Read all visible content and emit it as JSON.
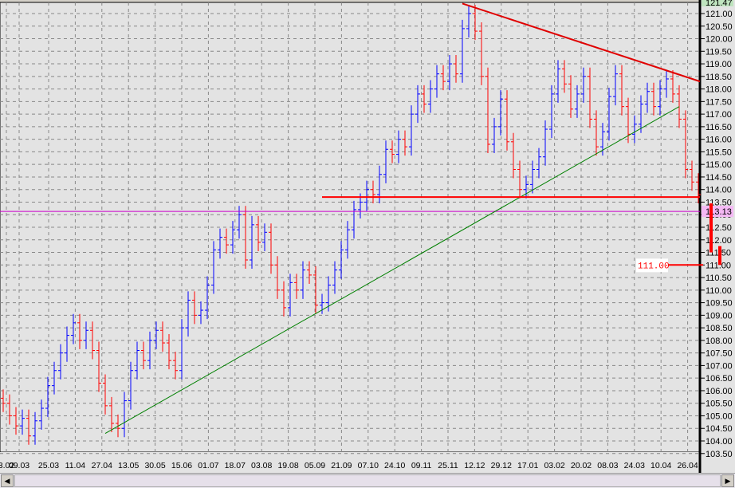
{
  "chart_data": {
    "type": "ohlc-bar",
    "ylim": [
      103.5,
      121.47
    ],
    "y_ticks": [
      103.5,
      104,
      104.5,
      105,
      105.5,
      106,
      106.5,
      107,
      107.5,
      108,
      108.5,
      109,
      109.5,
      110,
      110.5,
      111,
      111.5,
      112,
      112.5,
      113,
      113.5,
      114,
      114.5,
      115,
      115.5,
      116,
      116.5,
      117,
      117.5,
      118,
      118.5,
      119,
      119.5,
      120,
      120.5,
      121
    ],
    "x_labels": [
      "3.02",
      "09.03",
      "25.03",
      "11.04",
      "27.04",
      "13.05",
      "30.05",
      "15.06",
      "01.07",
      "18.07",
      "03.08",
      "19.08",
      "05.09",
      "21.09",
      "07.10",
      "24.10",
      "09.11",
      "25.11",
      "12.12",
      "29.12",
      "17.01",
      "03.02",
      "20.02",
      "08.03",
      "24.03",
      "10.04",
      "26.04"
    ],
    "closes": [
      105.5,
      105.0,
      104.6,
      104.9,
      104.2,
      104.8,
      105.3,
      106.2,
      106.8,
      107.5,
      108.2,
      108.7,
      108.0,
      108.4,
      107.6,
      106.3,
      105.4,
      104.7,
      104.5,
      105.6,
      106.8,
      107.6,
      107.2,
      108.0,
      108.4,
      107.9,
      107.2,
      106.8,
      108.5,
      109.6,
      109.0,
      109.2,
      110.2,
      111.6,
      112.1,
      111.8,
      112.4,
      113.0,
      111.2,
      112.6,
      111.9,
      112.3,
      111.0,
      110.0,
      109.3,
      110.3,
      110.0,
      110.8,
      110.6,
      109.4,
      109.5,
      110.2,
      110.8,
      111.6,
      112.4,
      113.2,
      113.5,
      114.0,
      113.8,
      114.6,
      115.6,
      115.4,
      116.0,
      115.7,
      117.0,
      117.8,
      117.4,
      118.0,
      118.6,
      118.3,
      119.0,
      118.6,
      120.4,
      121.0,
      120.3,
      118.5,
      115.8,
      116.5,
      117.6,
      115.9,
      114.8,
      114.0,
      114.2,
      114.8,
      115.3,
      116.4,
      117.8,
      118.8,
      118.2,
      117.2,
      117.8,
      118.5,
      116.8,
      115.7,
      116.3,
      117.7,
      118.6,
      117.3,
      116.2,
      116.6,
      117.4,
      117.9,
      117.3,
      118.0,
      118.4,
      117.8,
      116.8,
      114.8,
      114.3,
      113.8
    ],
    "up_color": "#0000ff",
    "down_color": "#ff0000",
    "trendlines": [
      {
        "kind": "resistance",
        "color": "#e00000",
        "from": [
          72,
          121.4
        ],
        "to": [
          110,
          118.3
        ]
      },
      {
        "kind": "support",
        "color": "#008000",
        "from": [
          16,
          104.3
        ],
        "to": [
          106,
          117.3
        ]
      },
      {
        "kind": "horizontal",
        "color": "#ff0000",
        "from": [
          50,
          113.7
        ],
        "to": [
          110,
          113.7
        ]
      }
    ],
    "level_line": {
      "value": 113.13,
      "label": "113.13",
      "color": "#cc00cc"
    },
    "last_high_label": "121.47",
    "target": {
      "label": "111.00",
      "value": 111.0,
      "color": "#ff0000"
    },
    "grid": true
  }
}
